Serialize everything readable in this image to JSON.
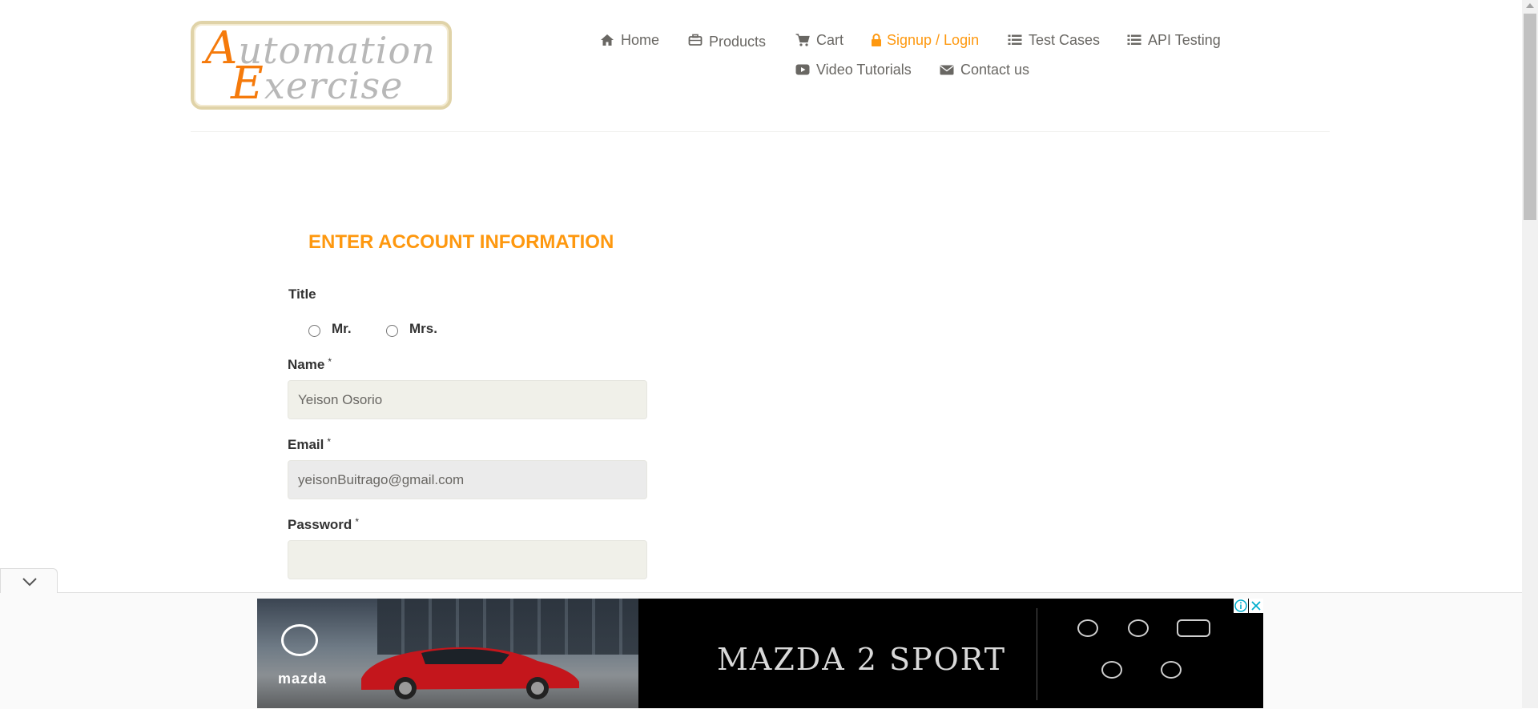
{
  "logo": {
    "line1_first": "A",
    "line1_rest": "utomation",
    "line2_first": "E",
    "line2_rest": "xercise"
  },
  "nav": {
    "row1": [
      {
        "label": "Home",
        "icon": "home-icon"
      },
      {
        "label": "Products",
        "icon": "briefcase-icon"
      },
      {
        "label": "Cart",
        "icon": "cart-icon"
      },
      {
        "label": "Signup / Login",
        "icon": "lock-icon",
        "active": true
      },
      {
        "label": "Test Cases",
        "icon": "list-icon"
      },
      {
        "label": "API Testing",
        "icon": "list-icon"
      }
    ],
    "row2": [
      {
        "label": "Video Tutorials",
        "icon": "youtube-play-icon"
      },
      {
        "label": "Contact us",
        "icon": "envelope-icon"
      }
    ]
  },
  "form": {
    "heading": "ENTER ACCOUNT INFORMATION",
    "title_label": "Title",
    "title_options": [
      "Mr.",
      "Mrs."
    ],
    "name_label": "Name",
    "name_value": "Yeison Osorio",
    "email_label": "Email",
    "email_value": "yeisonBuitrago@gmail.com",
    "password_label": "Password",
    "password_value": "",
    "required_mark": "*"
  },
  "ad": {
    "brand": "mazda",
    "headline": "MAZDA 2 SPORT"
  },
  "colors": {
    "accent": "#fe980f",
    "nav_text": "#696763",
    "label_text": "#333333",
    "field_bg": "#f0f0e9"
  }
}
